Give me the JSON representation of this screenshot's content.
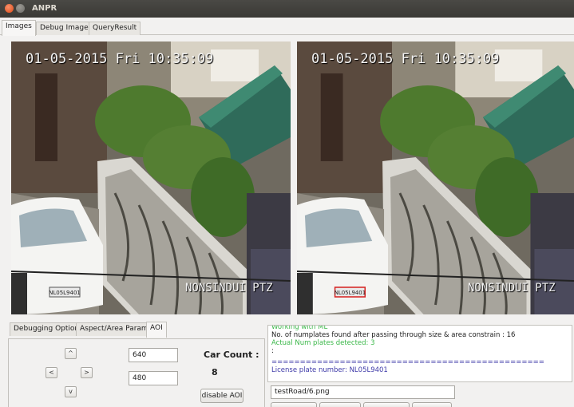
{
  "window": {
    "title": "ANPR"
  },
  "main_tabs": [
    {
      "label": "Images"
    },
    {
      "label": "Debug Images"
    },
    {
      "label": "QueryResult"
    }
  ],
  "images": {
    "left": {
      "timestamp": "01-05-2015 Fri 10:35:09",
      "camera": "NONSINDUI PTZ",
      "plate": "NL05L9401"
    },
    "right": {
      "timestamp": "01-05-2015 Fri 10:35:09",
      "camera": "NONSINDUI PTZ",
      "plate": "NL05L9401"
    }
  },
  "panel": {
    "tabs": [
      {
        "label": "Debugging Options"
      },
      {
        "label": "Aspect/Area Params"
      },
      {
        "label": "AOI"
      }
    ],
    "arrows": {
      "up": "^",
      "left": "<",
      "right": ">",
      "down": "v"
    },
    "width_value": "640",
    "height_value": "480",
    "car_count_label": "Car Count :",
    "car_count_value": "8",
    "disable_aoi_label": "disable AOI"
  },
  "log": {
    "lines": [
      {
        "text": "Working with ML",
        "color": "green"
      },
      {
        "text": "No. of numplates found after passing through size & area constrain : 16",
        "color": "black"
      },
      {
        "text": "Actual Num plates detected: 3",
        "color": "green"
      },
      {
        "text": ":",
        "color": "black"
      },
      {
        "text": "================================================",
        "color": "blue"
      },
      {
        "text": "License plate number: NL05L9401",
        "color": "blue"
      }
    ]
  },
  "path_input": {
    "value": "testRoad/6.png"
  }
}
